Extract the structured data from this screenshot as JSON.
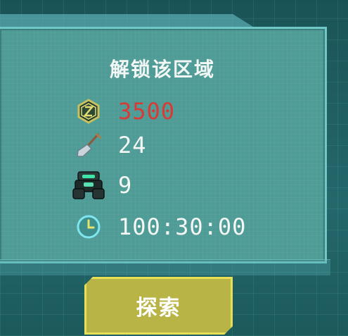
{
  "panel": {
    "title": "解锁该区域",
    "rows": [
      {
        "icon": "coin-icon",
        "value": "3500",
        "value_color": "#d93a35"
      },
      {
        "icon": "shovel-icon",
        "value": "24"
      },
      {
        "icon": "robot-icon",
        "value": "9"
      },
      {
        "icon": "clock-icon",
        "value": "100:30:00"
      }
    ]
  },
  "button": {
    "label": "探索"
  },
  "colors": {
    "panel_bg": "#4f9c96",
    "panel_border": "#6fc7c6",
    "button_bg": "#b8b446",
    "button_border": "#e8df58",
    "cost_red": "#d93a35"
  }
}
